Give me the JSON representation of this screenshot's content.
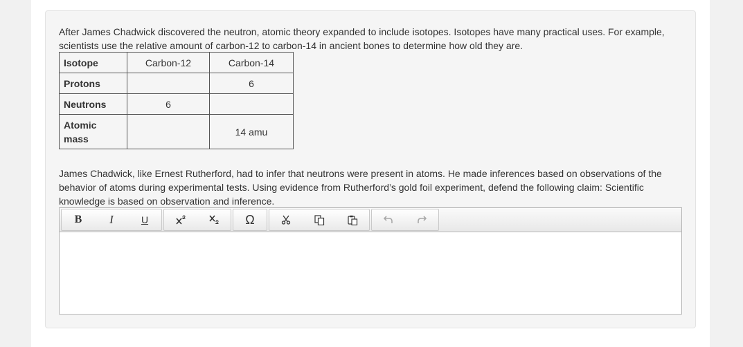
{
  "question": {
    "intro_text": "After James Chadwick discovered the neutron, atomic theory expanded to include isotopes. Isotopes have many practical uses. For example, scientists use the relative amount of carbon-12 to carbon-14 in ancient bones to determine how old they are.",
    "prompt_text": "James Chadwick, like Ernest Rutherford, had to infer that neutrons were present in atoms. He made inferences based on observations of the behavior of atoms during experimental tests. Using evidence from Rutherford’s gold foil experiment, defend the following claim: Scientific knowledge is based on observation and inference."
  },
  "table": {
    "headers": [
      "Isotope",
      "Carbon-12",
      "Carbon-14"
    ],
    "rows": [
      {
        "label": "Protons",
        "c12": "",
        "c14": "6"
      },
      {
        "label": "Neutrons",
        "c12": "6",
        "c14": ""
      },
      {
        "label": "Atomic mass",
        "c12": "",
        "c14": "14 amu"
      }
    ]
  },
  "editor": {
    "toolbar": {
      "bold": "B",
      "italic": "I",
      "underline": "U",
      "special_char": "Ω"
    },
    "value": ""
  },
  "icons": {
    "superscript": "superscript-icon",
    "subscript": "subscript-icon",
    "cut": "scissors-icon",
    "copy": "copy-icon",
    "paste": "paste-icon",
    "undo": "undo-icon",
    "redo": "redo-icon"
  }
}
